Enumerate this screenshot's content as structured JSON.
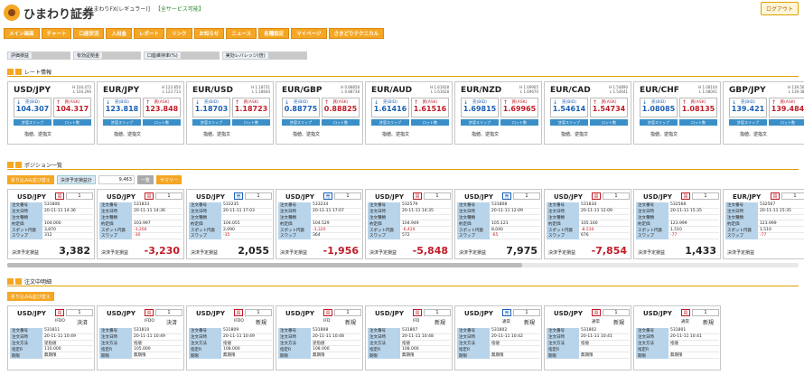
{
  "header": {
    "logo_text": "ひまわり証券",
    "account": "[ひまわりFX(レギュラー)]",
    "status": "【全サービス可能】",
    "logout": "ログアウト"
  },
  "nav": [
    "メイン画面",
    "チャート",
    "口座状況",
    "入出金",
    "レポート",
    "リンク",
    "お知らせ",
    "ニュース",
    "各種設定",
    "マイページ",
    "さきどりテクニカル"
  ],
  "stats": [
    "評価損益",
    "有効証拠金",
    "口座維持率(%)",
    "実効レバレッジ(倍)"
  ],
  "sections": {
    "rates": "レート情報",
    "positions": "ポジション一覧",
    "orders": "注文中明細"
  },
  "labels": {
    "bid": "売(BID)",
    "ask": "買(ASK)",
    "slippage": "許容スリップ",
    "lot": "ロット数",
    "limit_stop": "指値、逆指文",
    "pos_summary": "決済予定損益計",
    "pos_summary_value": "9,463",
    "btn_fold": "折り込み&並び替え",
    "btn_list": "一覧",
    "btn_summary": "サマリー",
    "pl_label": "決済予定損益",
    "row_order_no": "注文番号",
    "row_order_date": "注文日時",
    "row_order_kind": "注文種類",
    "row_price": "約定価",
    "row_swap_price": "スポット円貨",
    "row_swap": "スワップ",
    "row_method": "注文方法",
    "row_limit": "指定R",
    "row_term": "期限"
  },
  "rates": [
    {
      "pair": "USD/JPY",
      "hl": "H 104.472\nL 104.290",
      "bid": "104.30",
      "bid_pip": "7",
      "ask": "104.31",
      "ask_pip": "7"
    },
    {
      "pair": "EUR/JPY",
      "hl": "H 123.850\nL 123.713",
      "bid": "123.81",
      "bid_pip": "8",
      "ask": "123.84",
      "ask_pip": "8"
    },
    {
      "pair": "EUR/USD",
      "hl": "H 1.18731\nL 1.18640",
      "bid": "1.1870",
      "bid_pip": "3",
      "ask": "1.1872",
      "ask_pip": "3"
    },
    {
      "pair": "EUR/GBP",
      "hl": "H 0.88858\nL 0.88738",
      "bid": "0.8877",
      "bid_pip": "5",
      "ask": "0.8882",
      "ask_pip": "5"
    },
    {
      "pair": "EUR/AUD",
      "hl": "H 1.61928\nL 1.61628",
      "bid": "1.6141",
      "bid_pip": "6",
      "ask": "1.6151",
      "ask_pip": "6"
    },
    {
      "pair": "EUR/NZD",
      "hl": "H 1.69905\nL 1.69670",
      "bid": "1.6981",
      "bid_pip": "5",
      "ask": "1.6996",
      "ask_pip": "5"
    },
    {
      "pair": "EUR/CAD",
      "hl": "H 1.54890\nL 1.54641",
      "bid": "1.5461",
      "bid_pip": "4",
      "ask": "1.5473",
      "ask_pip": "4"
    },
    {
      "pair": "EUR/CHF",
      "hl": "H 1.08104\nL 1.08041",
      "bid": "1.0808",
      "bid_pip": "5",
      "ask": "1.0813",
      "ask_pip": "5"
    },
    {
      "pair": "GBP/JPY",
      "hl": "H 139.564\nL 139.380",
      "bid": "139.42",
      "bid_pip": "1",
      "ask": "139.48",
      "ask_pip": "4"
    }
  ],
  "positions": [
    {
      "pair": "USD/JPY",
      "side": "買",
      "lot": "1",
      "no": "531806",
      "date": "20-11-11 14:36",
      "price": "104.000",
      "swapp": "3,870",
      "swap": "312",
      "pl": "3,382",
      "neg": false
    },
    {
      "pair": "USD/JPY",
      "side": "買",
      "lot": "1",
      "no": "531833",
      "date": "20-11-11 14:36",
      "price": "103.997",
      "swapp": "-3,200",
      "swap": "-30",
      "pl": "-3,230",
      "neg": true
    },
    {
      "pair": "USD/JPY",
      "side": "売",
      "lot": "1",
      "no": "533235",
      "date": "20-11-11 17:03",
      "price": "104.055",
      "swapp": "2,090",
      "swap": "-35",
      "pl": "2,055",
      "neg": false
    },
    {
      "pair": "USD/JPY",
      "side": "売",
      "lot": "1",
      "no": "533234",
      "date": "20-11-11 17:07",
      "price": "104.529",
      "swapp": "-3,320",
      "swap": "364",
      "pl": "-1,956",
      "neg": true
    },
    {
      "pair": "USD/JPY",
      "side": "買",
      "lot": "1",
      "no": "532579",
      "date": "20-11-11 14:35",
      "price": "104.949",
      "swapp": "-6,420",
      "swap": "572",
      "pl": "-5,848",
      "neg": true
    },
    {
      "pair": "USD/JPY",
      "side": "売",
      "lot": "1",
      "no": "531808",
      "date": "20-11-11 12:09",
      "price": "105.121",
      "swapp": "8,040",
      "swap": "-65",
      "pl": "7,975",
      "neg": false
    },
    {
      "pair": "USD/JPY",
      "side": "買",
      "lot": "1",
      "no": "531834",
      "date": "20-11-11 12:09",
      "price": "105.160",
      "swapp": "-8,530",
      "swap": "676",
      "pl": "-7,854",
      "neg": true
    },
    {
      "pair": "USD/JPY",
      "side": "買",
      "lot": "1",
      "no": "532568",
      "date": "20-11-11 15:35",
      "price": "123.999",
      "swapp": "1,510",
      "swap": "-77",
      "pl": "1,433",
      "neg": false
    },
    {
      "pair": "EUR/JPY",
      "side": "買",
      "lot": "1",
      "no": "532567",
      "date": "20-11-11 15:35",
      "price": "123.999",
      "swapp": "1,510",
      "swap": "-77",
      "pl": "",
      "neg": false
    }
  ],
  "orders": [
    {
      "pair": "USD/JPY",
      "side": "買",
      "lot": "1",
      "type": "IFDO",
      "kind": "決済",
      "no": "531811",
      "date": "20-11-11 10:49",
      "method": "逆指値",
      "limit": "110.000",
      "term": "無期限"
    },
    {
      "pair": "USD/JPY",
      "side": "買",
      "lot": "1",
      "type": "IFDO",
      "kind": "決済",
      "no": "531810",
      "date": "20-11-11 10:49",
      "method": "指値",
      "limit": "105.000",
      "term": "無期限"
    },
    {
      "pair": "USD/JPY",
      "side": "買",
      "lot": "1",
      "type": "IFDO",
      "kind": "新規",
      "no": "531809",
      "date": "20-11-11 10:49",
      "method": "指値",
      "limit": "108.000",
      "term": "無期限"
    },
    {
      "pair": "USD/JPY",
      "side": "買",
      "lot": "1",
      "type": "IFD",
      "kind": "新規",
      "no": "531808",
      "date": "20-11-11 10:48",
      "method": "逆指値",
      "limit": "108.000",
      "term": "無期限"
    },
    {
      "pair": "USD/JPY",
      "side": "買",
      "lot": "1",
      "type": "IFD",
      "kind": "新規",
      "no": "531807",
      "date": "20-11-11 10:48",
      "method": "指値",
      "limit": "108.000",
      "term": "無期限"
    },
    {
      "pair": "USD/JPY",
      "side": "売",
      "lot": "1",
      "type": "通常",
      "kind": "新規",
      "no": "531802",
      "date": "20-11-11 10:42",
      "method": "指値",
      "limit": "",
      "term": "無期限"
    },
    {
      "pair": "USD/JPY",
      "side": "買",
      "lot": "1",
      "type": "通常",
      "kind": "新規",
      "no": "531802",
      "date": "20-11-11 10:41",
      "method": "指値",
      "limit": "",
      "term": "無期限"
    },
    {
      "pair": "USD/JPY",
      "side": "買",
      "lot": "1",
      "type": "通常",
      "kind": "新規",
      "no": "531801",
      "date": "20-11-11 10:41",
      "method": "指値",
      "limit": "",
      "term": "無期限"
    }
  ],
  "colors": {
    "accent": "#f5a623",
    "bid": "#1a5fb4",
    "ask": "#c01c28",
    "row_key": "#b8d4ea"
  }
}
